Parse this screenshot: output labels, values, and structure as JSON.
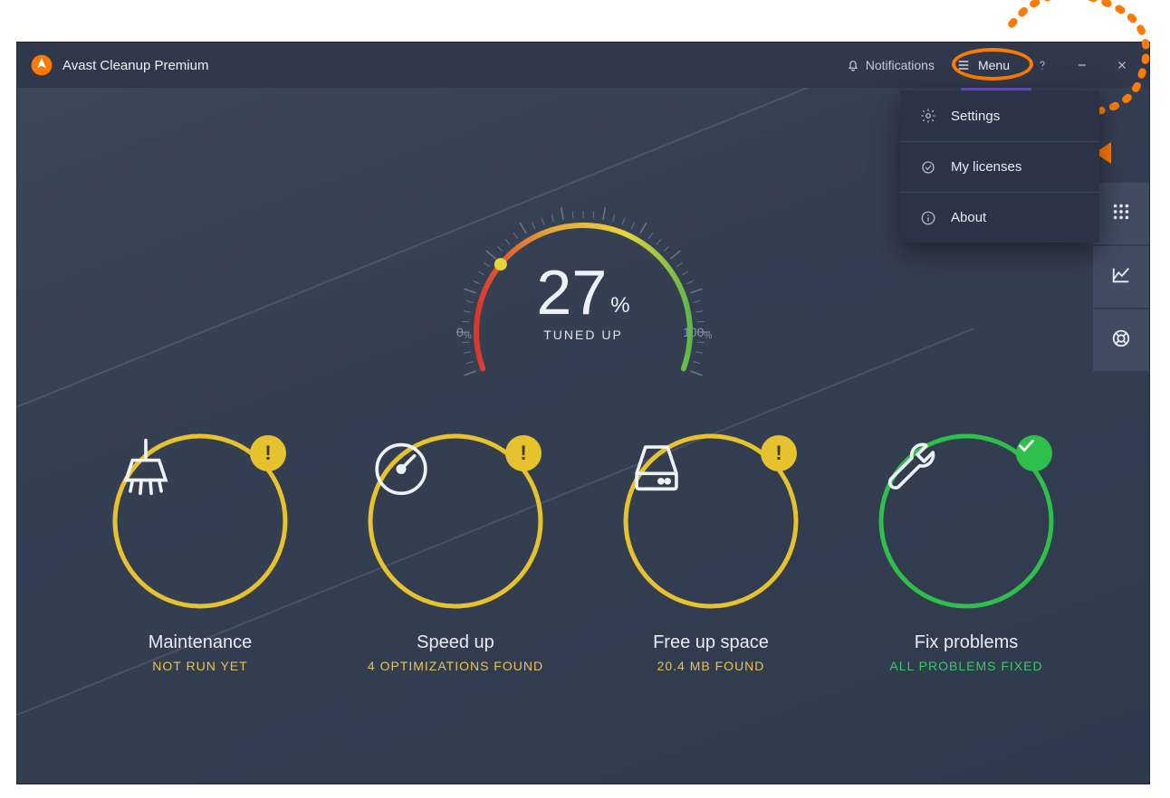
{
  "app": {
    "title": "Avast Cleanup Premium"
  },
  "titlebar": {
    "notifications_label": "Notifications",
    "menu_label": "Menu"
  },
  "menu_dropdown": {
    "items": [
      {
        "icon": "gear-icon",
        "label": "Settings"
      },
      {
        "icon": "license-icon",
        "label": "My licenses"
      },
      {
        "icon": "info-icon",
        "label": "About"
      }
    ]
  },
  "sidebar": {
    "items": [
      {
        "icon": "grid-icon"
      },
      {
        "icon": "chart-icon"
      },
      {
        "icon": "lifebuoy-icon"
      }
    ]
  },
  "gauge": {
    "value": "27",
    "percent_symbol": "%",
    "label": "TUNED UP",
    "min_label": "0",
    "min_pct": "%",
    "max_label": "100",
    "max_pct": "%",
    "percent": 27
  },
  "tiles": [
    {
      "id": "maintenance",
      "icon": "broom-icon",
      "ring": "warn",
      "badge": "warn",
      "title": "Maintenance",
      "subtitle": "NOT RUN YET",
      "sub_class": "sub-warn"
    },
    {
      "id": "speed-up",
      "icon": "gauge-icon",
      "ring": "warn",
      "badge": "warn",
      "title": "Speed up",
      "subtitle": "4 OPTIMIZATIONS FOUND",
      "sub_class": "sub-warn"
    },
    {
      "id": "free-space",
      "icon": "disk-icon",
      "ring": "warn",
      "badge": "warn",
      "title": "Free up space",
      "subtitle": "20.4 MB FOUND",
      "sub_class": "sub-warn"
    },
    {
      "id": "fix-problems",
      "icon": "wrench-icon",
      "ring": "ok",
      "badge": "ok",
      "title": "Fix problems",
      "subtitle": "ALL PROBLEMS FIXED",
      "sub_class": "sub-ok"
    }
  ],
  "colors": {
    "ring_warn": "#e6c22f",
    "ring_ok": "#2fbf4b",
    "accent": "#ff7a00",
    "purple": "#7b3ff2"
  },
  "chart_data": {
    "type": "gauge",
    "title": "TUNED UP",
    "value": 27,
    "min": 0,
    "max": 100,
    "unit": "%",
    "min_label": "0%",
    "max_label": "100%",
    "color_stops": [
      {
        "pct": 0,
        "color": "#d9362f"
      },
      {
        "pct": 35,
        "color": "#e6a53a"
      },
      {
        "pct": 75,
        "color": "#e6d43a"
      },
      {
        "pct": 100,
        "color": "#5fb74a"
      }
    ]
  }
}
